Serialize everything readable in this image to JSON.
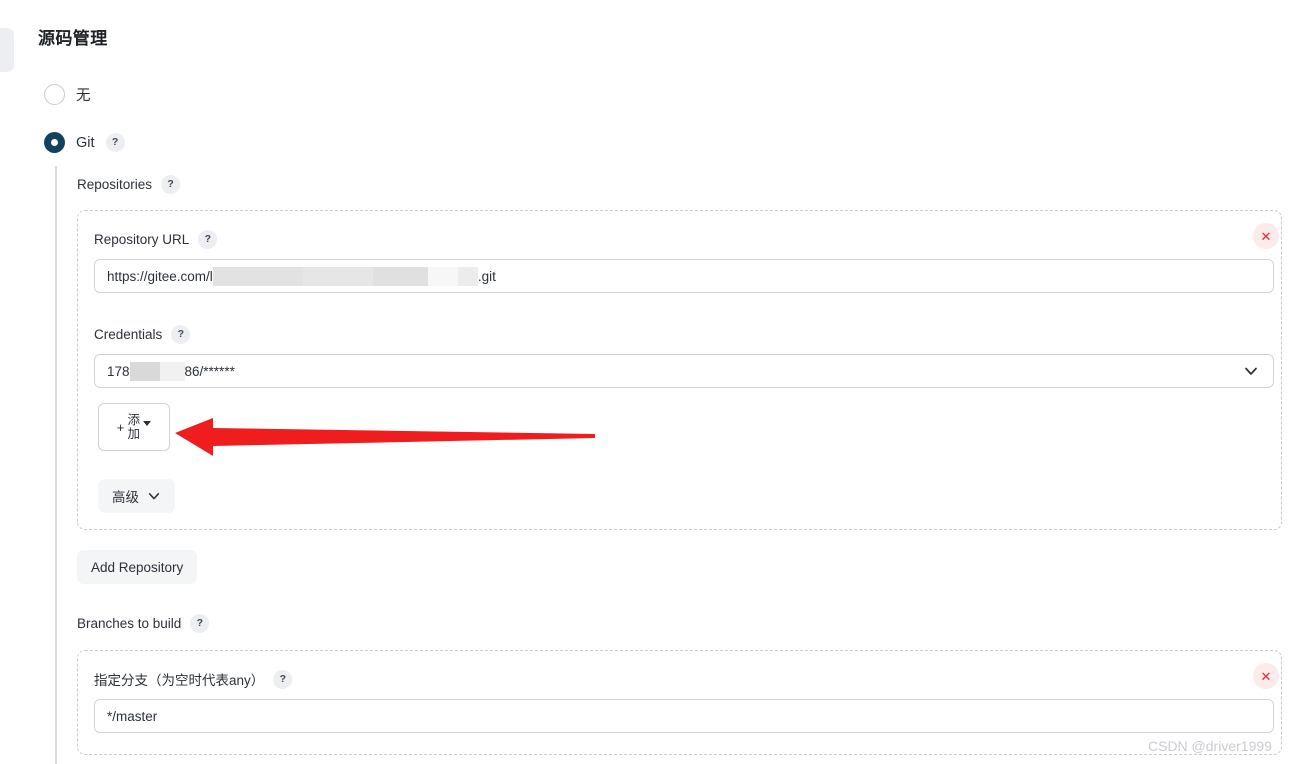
{
  "page": {
    "title": "源码管理",
    "watermark": "CSDN @driver1999"
  },
  "scm_options": {
    "none": {
      "label": "无",
      "selected": false
    },
    "git": {
      "label": "Git",
      "selected": true,
      "help": "?"
    }
  },
  "git_section": {
    "repositories_label": "Repositories",
    "repositories_help": "?",
    "repository": {
      "url_label": "Repository URL",
      "url_help": "?",
      "url_prefix": "https://gitee.com/l",
      "url_suffix": ".git",
      "credentials_label": "Credentials",
      "credentials_help": "?",
      "credentials_prefix": "178",
      "credentials_middle": "86/******",
      "add_credentials_label": "添加",
      "add_credentials_plus": "+",
      "advanced_label": "高级",
      "delete_label": "✕"
    },
    "add_repository_label": "Add Repository",
    "branches_label": "Branches to build",
    "branches_help": "?",
    "branch": {
      "spec_label": "指定分支（为空时代表any）",
      "spec_help": "?",
      "spec_value": "*/master",
      "delete_label": "✕"
    }
  },
  "colors": {
    "accent": "#14415f",
    "danger": "#d62b3b",
    "danger_bg": "#fdeaea",
    "arrow": "#ef1d1d",
    "border": "#ccd4da",
    "dashed_border": "#c3cbd3",
    "pill_bg": "#f4f5f7",
    "text": "#2b3138"
  }
}
